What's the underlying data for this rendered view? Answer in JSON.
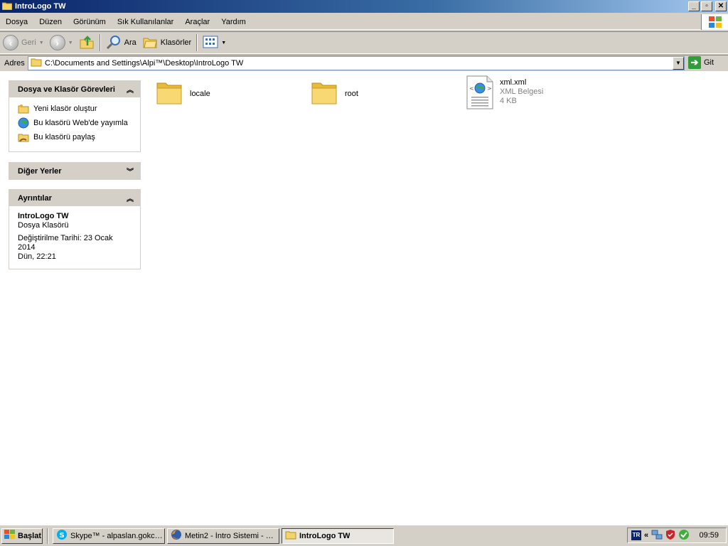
{
  "window": {
    "title": "IntroLogo TW"
  },
  "menu": [
    "Dosya",
    "Düzen",
    "Görünüm",
    "Sık Kullanılanlar",
    "Araçlar",
    "Yardım"
  ],
  "toolbar": {
    "back": "Geri",
    "search": "Ara",
    "folders": "Klasörler"
  },
  "address": {
    "label": "Adres",
    "path": "C:\\Documents and Settings\\Alpi™\\Desktop\\IntroLogo TW",
    "go": "Git"
  },
  "tasks_panel": {
    "title": "Dosya ve Klasör Görevleri",
    "items": [
      "Yeni klasör oluştur",
      "Bu klasörü Web'de yayımla",
      "Bu klasörü paylaş"
    ]
  },
  "other_places": {
    "title": "Diğer Yerler"
  },
  "details": {
    "title": "Ayrıntılar",
    "name": "IntroLogo TW",
    "type": "Dosya Klasörü",
    "modified_line1": "Değiştirilme Tarihi: 23 Ocak 2014",
    "modified_line2": "Dün, 22:21"
  },
  "files": [
    {
      "name": "locale",
      "kind": "folder"
    },
    {
      "name": "root",
      "kind": "folder"
    },
    {
      "name": "xml.xml",
      "kind": "xml",
      "type": "XML Belgesi",
      "size": "4 KB"
    }
  ],
  "taskbar": {
    "start": "Başlat",
    "tasks": [
      "Skype™ - alpaslan.gokce...",
      "Metin2 - İntro Sistemi - M...",
      "IntroLogo TW"
    ],
    "lang": "TR",
    "tray_expand": "«",
    "clock": "09:59"
  }
}
